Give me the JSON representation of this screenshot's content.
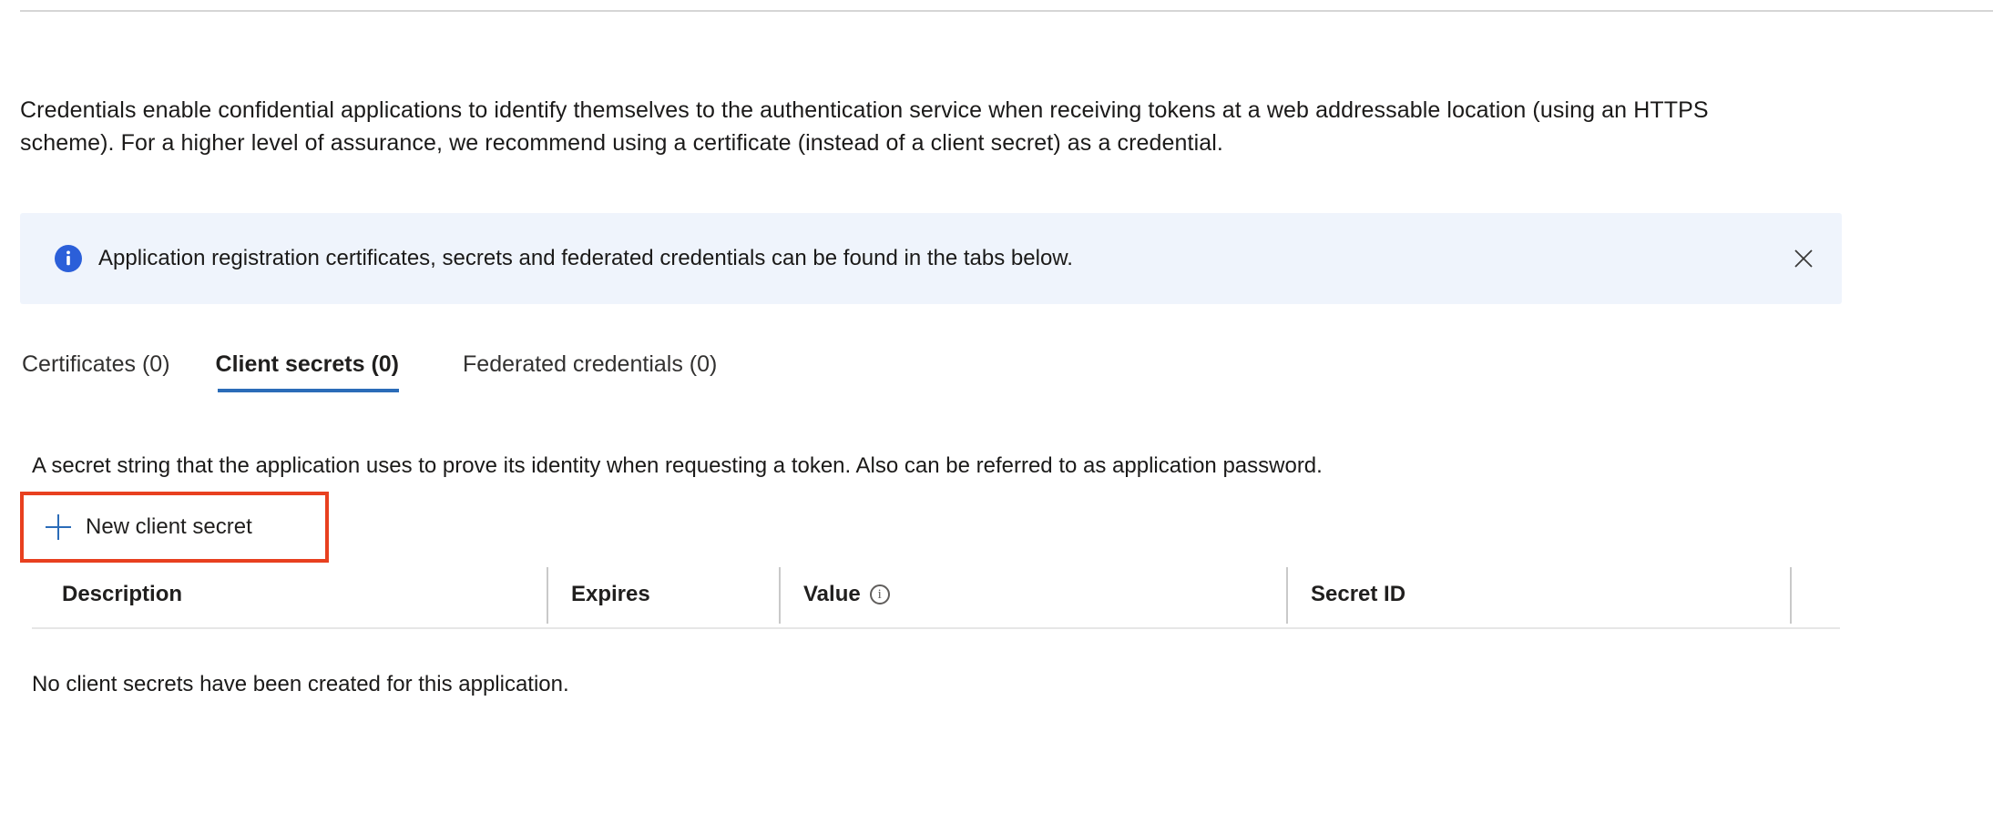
{
  "intro": {
    "paragraph": "Credentials enable confidential applications to identify themselves to the authentication service when receiving tokens at a web addressable location (using an HTTPS scheme). For a higher level of assurance, we recommend using a certificate (instead of a client secret) as a credential."
  },
  "banner": {
    "icon": "info-icon",
    "message": "Application registration certificates, secrets and federated credentials can be found in the tabs below.",
    "close_icon": "close-icon",
    "background_color": "#eff4fc",
    "icon_color": "#2b5fd9"
  },
  "tabs": [
    {
      "label": "Certificates (0)",
      "active": false
    },
    {
      "label": "Client secrets (0)",
      "active": true
    },
    {
      "label": "Federated credentials (0)",
      "active": false
    }
  ],
  "tab_accent_color": "#2b6cb8",
  "section": {
    "description": "A secret string that the application uses to prove its identity when requesting a token. Also can be referred to as application password."
  },
  "command_bar": {
    "new_secret_label": "New client secret",
    "plus_icon": "plus-icon",
    "highlight_color": "#e8401f"
  },
  "table": {
    "columns": [
      {
        "label": "Description"
      },
      {
        "label": "Expires"
      },
      {
        "label": "Value",
        "info_icon": "info-outline-icon"
      },
      {
        "label": "Secret ID"
      }
    ],
    "rows": [],
    "empty_message": "No client secrets have been created for this application."
  }
}
